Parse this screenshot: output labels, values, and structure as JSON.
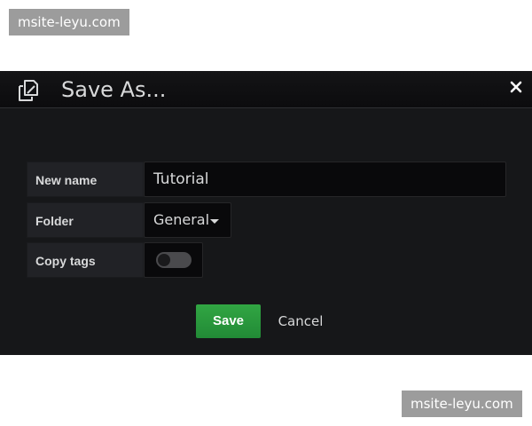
{
  "watermarks": {
    "top": "msite-leyu.com",
    "bottom": "msite-leyu.com"
  },
  "dialog": {
    "title": "Save As...",
    "header_icon": "copy-icon",
    "close_icon": "close-icon"
  },
  "form": {
    "name_label": "New name",
    "name_value": "Tutorial",
    "folder_label": "Folder",
    "folder_value": "General",
    "copy_tags_label": "Copy tags",
    "copy_tags_enabled": false
  },
  "buttons": {
    "save_label": "Save",
    "cancel_label": "Cancel"
  },
  "colors": {
    "background": "#161719",
    "label_bg": "#212226",
    "input_bg": "#09090b",
    "text": "#d8d9da",
    "save_green": "#2a9a3c"
  }
}
